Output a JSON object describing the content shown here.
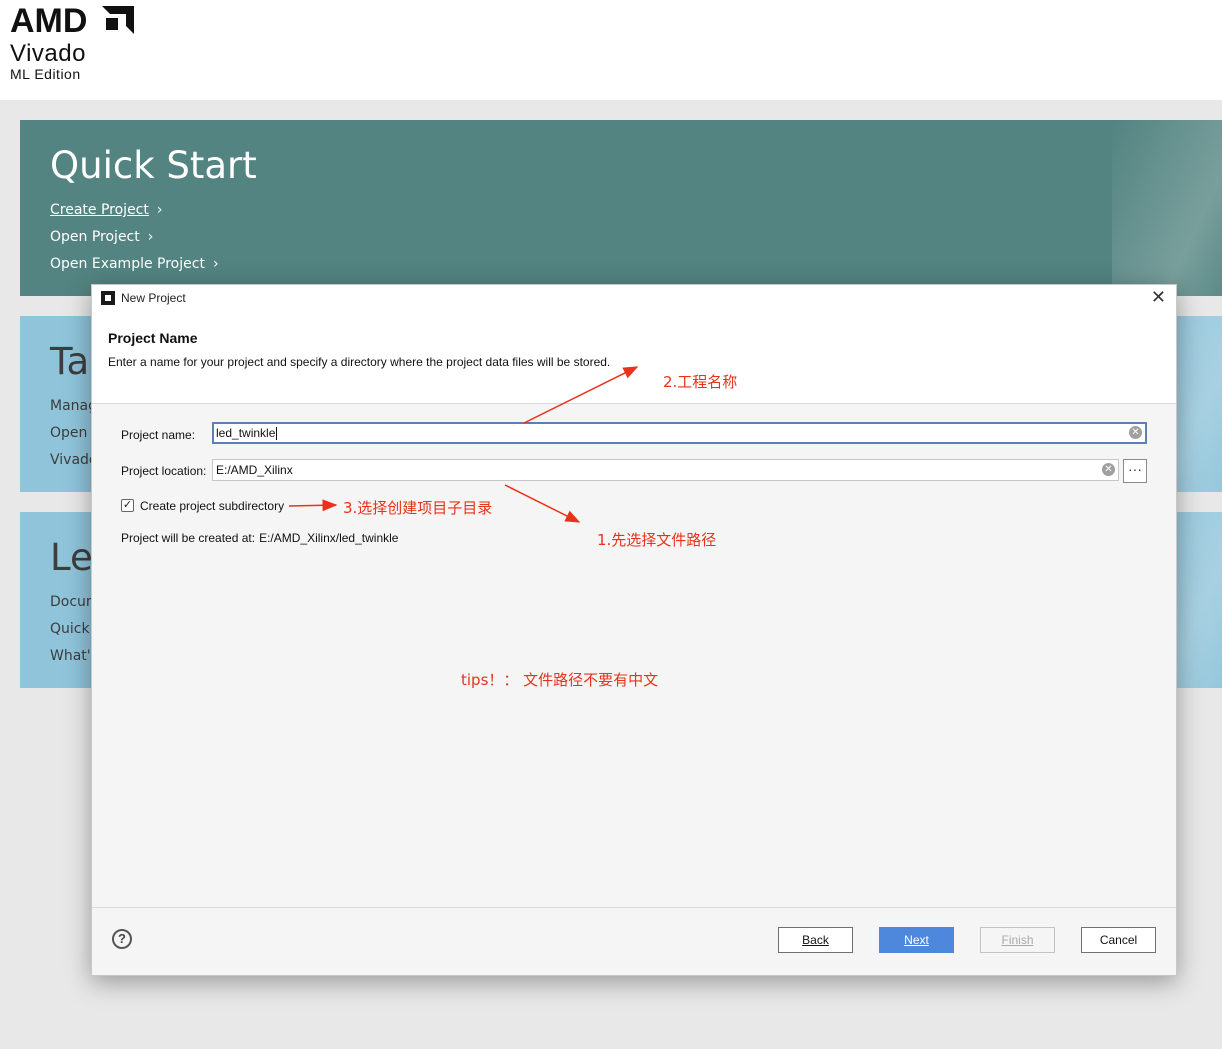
{
  "brand": {
    "company": "AMD",
    "product": "Vivado",
    "edition": "ML Edition"
  },
  "quick_start": {
    "title": "Quick Start",
    "links": [
      "Create Project",
      "Open Project",
      "Open Example Project"
    ]
  },
  "tasks": {
    "title": "Tas",
    "links": [
      "Manag",
      "Open",
      "Vivado"
    ]
  },
  "learn": {
    "title": "Le",
    "links": [
      "Docum",
      "Quick",
      "What's"
    ]
  },
  "dialog": {
    "title": "New Project",
    "section_title": "Project Name",
    "section_desc": "Enter a name for your project and specify a directory where the project data files will be stored.",
    "project_name_label": "Project name:",
    "project_name_value": "led_twinkle",
    "project_location_label": "Project location:",
    "project_location_value": "E:/AMD_Xilinx",
    "browse_label": "···",
    "subdir_label": "Create project subdirectory",
    "subdir_checked": true,
    "created_at_label": "Project will be created at:",
    "created_at_value": "E:/AMD_Xilinx/led_twinkle",
    "help_label": "?",
    "buttons": {
      "back": "Back",
      "next": "Next",
      "finish": "Finish",
      "cancel": "Cancel"
    }
  },
  "annotations": {
    "a1": "1.先选择文件路径",
    "a2": "2.工程名称",
    "a3": "3.选择创建项目子目录",
    "tip": "tips！： 文件路径不要有中文"
  },
  "colors": {
    "accent": "#4e88dc",
    "quick_panel": "#538481",
    "info_panel": "#8fc4da",
    "annotation": "#e8321b"
  }
}
